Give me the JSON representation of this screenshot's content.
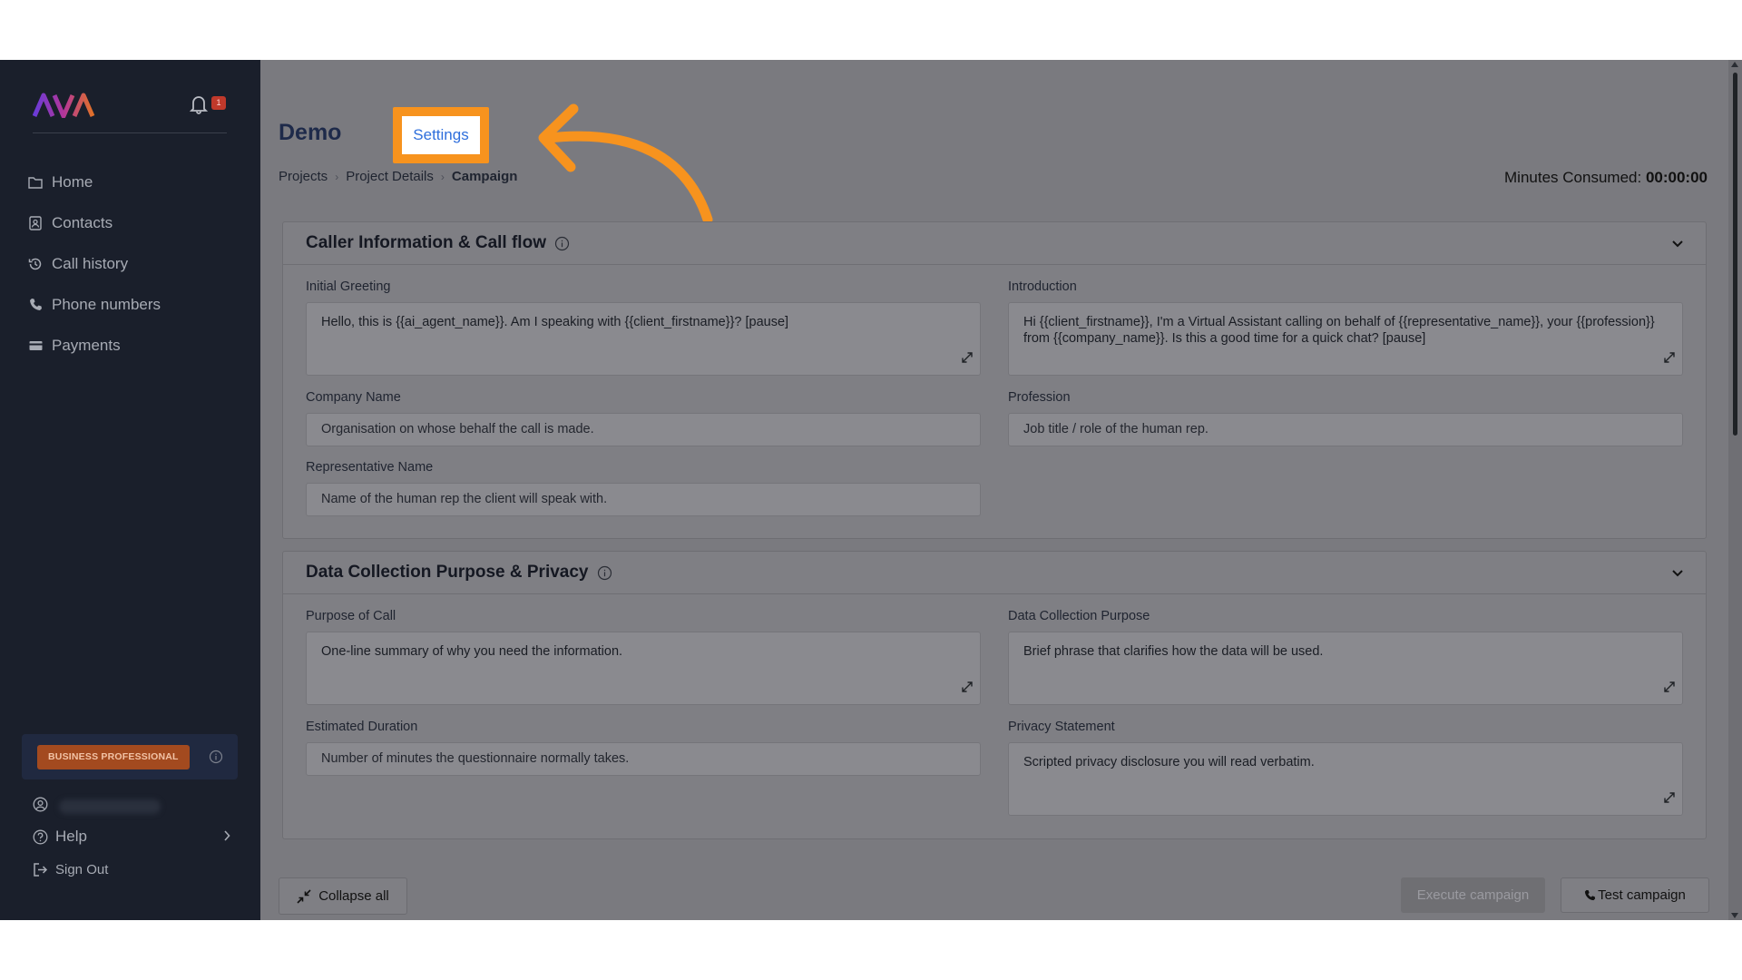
{
  "sidebar": {
    "logo_text": "AVA",
    "notification_count": "1",
    "nav": [
      {
        "label": "Home",
        "icon": "folder-icon"
      },
      {
        "label": "Contacts",
        "icon": "contact-card-icon"
      },
      {
        "label": "Call history",
        "icon": "history-icon"
      },
      {
        "label": "Phone numbers",
        "icon": "phone-icon"
      },
      {
        "label": "Payments",
        "icon": "card-icon"
      }
    ],
    "plan_badge": "BUSINESS PROFESSIONAL",
    "help_label": "Help",
    "signout_label": "Sign Out"
  },
  "header": {
    "title": "Demo",
    "settings_label": "Settings",
    "breadcrumb": [
      "Projects",
      "Project Details",
      "Campaign"
    ],
    "minutes_label": "Minutes Consumed:",
    "minutes_value": "00:00:00"
  },
  "sections": {
    "caller": {
      "title": "Caller Information & Call flow",
      "initial_greeting_label": "Initial Greeting",
      "initial_greeting_value": "Hello, this is {{ai_agent_name}}.  Am I speaking with {{client_firstname}}? [pause]",
      "introduction_label": "Introduction",
      "introduction_value": "Hi {{client_firstname}}, I'm a Virtual Assistant calling on behalf of {{representative_name}}, your {{profession}} from {{company_name}}. Is this a good time for a quick chat? [pause]",
      "company_label": "Company Name",
      "company_placeholder": "Organisation on whose behalf the call is made.",
      "profession_label": "Profession",
      "profession_placeholder": "Job title / role of the human rep.",
      "rep_label": "Representative Name",
      "rep_placeholder": "Name of the human rep the client will speak with."
    },
    "privacy": {
      "title": "Data Collection Purpose & Privacy",
      "purpose_label": "Purpose of Call",
      "purpose_placeholder": "One-line summary of why you need the information.",
      "data_purpose_label": "Data Collection Purpose",
      "data_purpose_placeholder": "Brief phrase that clarifies how the data will be used.",
      "duration_label": "Estimated Duration",
      "duration_placeholder": "Number of minutes the questionnaire normally takes.",
      "privacy_label": "Privacy Statement",
      "privacy_placeholder": "Scripted privacy disclosure you will read verbatim."
    }
  },
  "footer": {
    "collapse_label": "Collapse all",
    "execute_label": "Execute campaign",
    "test_label": "Test campaign"
  },
  "colors": {
    "sidebar_bg": "#1a1f2b",
    "highlight": "#f7931e",
    "link_blue": "#2f6fdc",
    "plan_badge": "#a34a1f"
  }
}
